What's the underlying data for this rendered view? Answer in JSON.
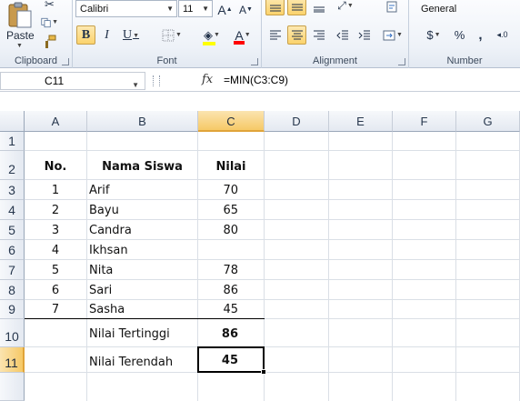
{
  "ribbon": {
    "clipboard": {
      "label": "Clipboard",
      "paste_label": "Paste"
    },
    "font": {
      "label": "Font",
      "font_name": "Calibri",
      "font_size": "11",
      "grow_glyph": "A",
      "shrink_glyph": "A",
      "bold_glyph": "B",
      "italic_glyph": "I",
      "underline_glyph": "U",
      "font_color_glyph": "A",
      "fill_color": "#ffff00",
      "font_color": "#ff0000"
    },
    "alignment": {
      "label": "Alignment"
    },
    "number": {
      "label": "Number",
      "format": "General",
      "currency_glyph": "$",
      "percent_glyph": "%",
      "comma_glyph": ","
    }
  },
  "formula_bar": {
    "name_box": "C11",
    "fx_label": "fx",
    "formula": "=MIN(C3:C9)"
  },
  "columns": [
    "A",
    "B",
    "C",
    "D",
    "E",
    "F",
    "G"
  ],
  "rows": [
    "1",
    "2",
    "3",
    "4",
    "5",
    "6",
    "7",
    "8",
    "9",
    "10",
    "11"
  ],
  "table": {
    "headers": {
      "no": "No.",
      "name": "Nama Siswa",
      "score": "Nilai"
    },
    "students": [
      {
        "no": "1",
        "name": "Arif",
        "score": "70"
      },
      {
        "no": "2",
        "name": "Bayu",
        "score": "65"
      },
      {
        "no": "3",
        "name": "Candra",
        "score": "80"
      },
      {
        "no": "4",
        "name": "Ikhsan",
        "score": ""
      },
      {
        "no": "5",
        "name": "Nita",
        "score": "78"
      },
      {
        "no": "6",
        "name": "Sari",
        "score": "86"
      },
      {
        "no": "7",
        "name": "Sasha",
        "score": "45"
      }
    ],
    "summary": [
      {
        "label": "Nilai Tertinggi",
        "value": "86"
      },
      {
        "label": "Nilai Terendah",
        "value": "45"
      }
    ]
  }
}
